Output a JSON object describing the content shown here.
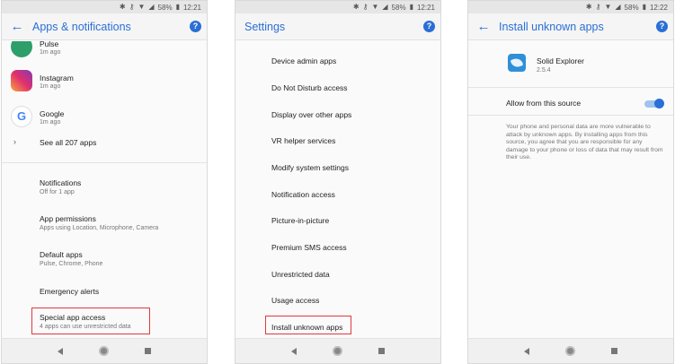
{
  "status": {
    "battery": "58%",
    "time1": "12:21",
    "time2": "12:21",
    "time3": "12:22"
  },
  "phone1": {
    "title": "Apps & notifications",
    "apps": [
      {
        "name": "Pulse",
        "sub": "1m ago"
      },
      {
        "name": "Instagram",
        "sub": "1m ago"
      },
      {
        "name": "Google",
        "sub": "1m ago"
      }
    ],
    "see_all": "See all 207 apps",
    "settings": [
      {
        "title": "Notifications",
        "sub": "Off for 1 app"
      },
      {
        "title": "App permissions",
        "sub": "Apps using Location, Microphone, Camera"
      },
      {
        "title": "Default apps",
        "sub": "Pulse, Chrome, Phone"
      },
      {
        "title": "Emergency alerts",
        "sub": ""
      },
      {
        "title": "Special app access",
        "sub": "4 apps can use unrestricted data"
      }
    ]
  },
  "phone2": {
    "title": "Settings",
    "items": [
      "Device admin apps",
      "Do Not Disturb access",
      "Display over other apps",
      "VR helper services",
      "Modify system settings",
      "Notification access",
      "Picture-in-picture",
      "Premium SMS access",
      "Unrestricted data",
      "Usage access",
      "Install unknown apps"
    ]
  },
  "phone3": {
    "title": "Install unknown apps",
    "app_name": "Solid Explorer",
    "app_version": "2.5.4",
    "allow_label": "Allow from this source",
    "allow_enabled": true,
    "description": "Your phone and personal data are more vulnerable to attack by unknown apps. By installing apps from this source, you agree that you are responsible for any damage to your phone or loss of data that may result from their use."
  },
  "colors": {
    "accent": "#2a6fd6",
    "highlight": "#e0393e"
  },
  "icons": {
    "back": "arrow-left-icon",
    "help": "question-icon",
    "chevron": "chevron-right-icon"
  }
}
